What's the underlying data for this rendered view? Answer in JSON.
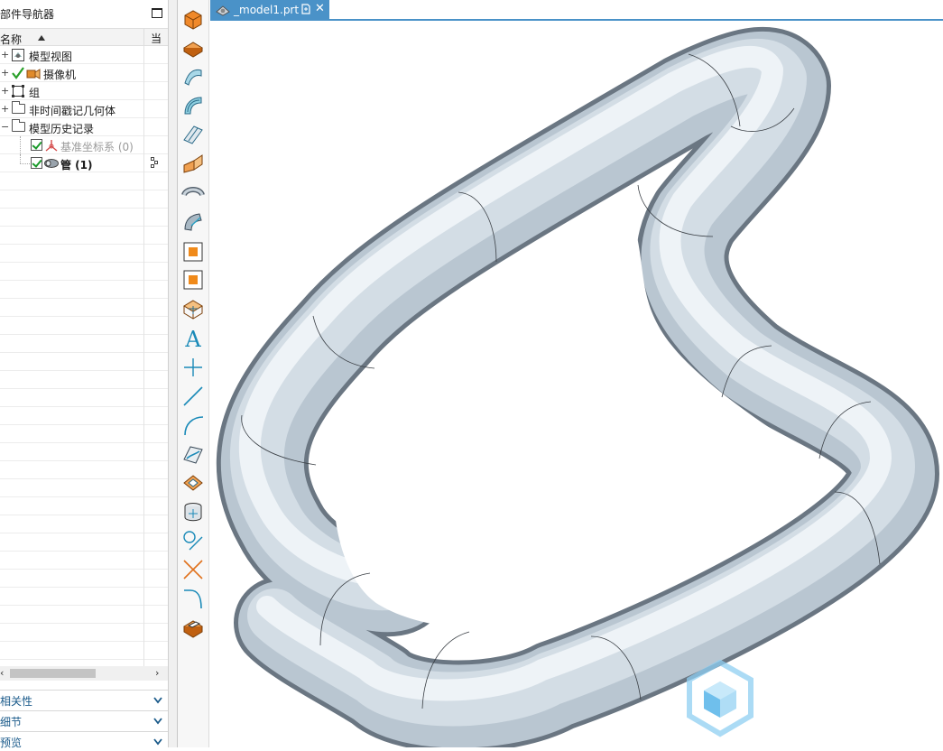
{
  "navigator": {
    "title": "部件导航器",
    "column_name": "名称",
    "column_current": "当",
    "items": [
      {
        "label": "模型视图",
        "expander": "+"
      },
      {
        "label": "摄像机",
        "expander": "+"
      },
      {
        "label": "组",
        "expander": "+"
      },
      {
        "label": "非时间戳记几何体",
        "expander": "+"
      },
      {
        "label": "模型历史记录",
        "expander": "−"
      },
      {
        "label": "基准坐标系 (0)"
      },
      {
        "label": "管 (1)"
      }
    ]
  },
  "panels": [
    {
      "label": "相关性"
    },
    {
      "label": "细节"
    },
    {
      "label": "预览"
    }
  ],
  "toolbar": {
    "tools": [
      "block-icon",
      "extrude-icon",
      "surface-icon",
      "swept-surface-icon",
      "ruled-surface-icon",
      "sheet-metal-icon",
      "pipe-icon",
      "surface-patch-icon",
      "square-point-icon",
      "square-point-alt-icon",
      "datum-csys-icon",
      "text-icon",
      "point-icon",
      "line-icon",
      "arc-icon",
      "curve-on-surface-icon",
      "offset-face-icon",
      "cylinder-icon",
      "circle-line-icon",
      "intersect-curve-icon",
      "fillet-curve-icon",
      "edit-feature-icon"
    ]
  },
  "document_tab": {
    "label": "_model1.prt",
    "close": "✕"
  },
  "colors": {
    "accent": "#4a92c8",
    "pipe_light": "#f4f8fb",
    "pipe_mid": "#c6d2dc",
    "pipe_dark": "#5d6a76",
    "watermark": "#5fb0e6"
  }
}
